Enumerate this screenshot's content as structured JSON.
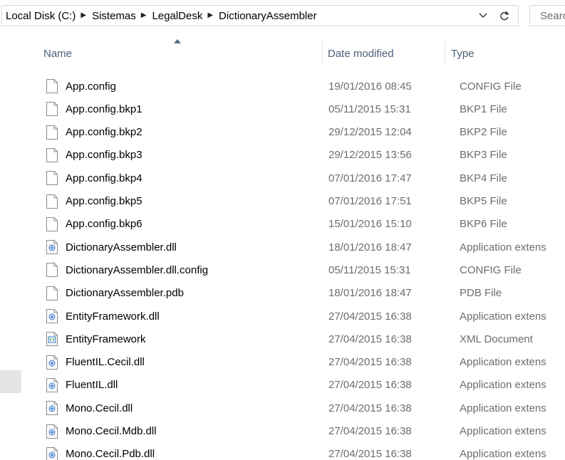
{
  "address": {
    "crumbs": [
      "Local Disk (C:)",
      "Sistemas",
      "LegalDesk",
      "DictionaryAssembler"
    ],
    "search_placeholder": "Search"
  },
  "columns": {
    "name": "Name",
    "date": "Date modified",
    "type": "Type",
    "sorted_by": "name"
  },
  "files": [
    {
      "name": "App.config",
      "date": "19/01/2016 08:45",
      "type": "CONFIG File",
      "icon": "blank-file-icon"
    },
    {
      "name": "App.config.bkp1",
      "date": "05/11/2015 15:31",
      "type": "BKP1 File",
      "icon": "blank-file-icon"
    },
    {
      "name": "App.config.bkp2",
      "date": "29/12/2015 12:04",
      "type": "BKP2 File",
      "icon": "blank-file-icon"
    },
    {
      "name": "App.config.bkp3",
      "date": "29/12/2015 13:56",
      "type": "BKP3 File",
      "icon": "blank-file-icon"
    },
    {
      "name": "App.config.bkp4",
      "date": "07/01/2016 17:47",
      "type": "BKP4 File",
      "icon": "blank-file-icon"
    },
    {
      "name": "App.config.bkp5",
      "date": "07/01/2016 17:51",
      "type": "BKP5 File",
      "icon": "blank-file-icon"
    },
    {
      "name": "App.config.bkp6",
      "date": "15/01/2016 15:10",
      "type": "BKP6 File",
      "icon": "blank-file-icon"
    },
    {
      "name": "DictionaryAssembler.dll",
      "date": "18/01/2016 18:47",
      "type": "Application extens",
      "icon": "dll-file-icon"
    },
    {
      "name": "DictionaryAssembler.dll.config",
      "date": "05/11/2015 15:31",
      "type": "CONFIG File",
      "icon": "blank-file-icon"
    },
    {
      "name": "DictionaryAssembler.pdb",
      "date": "18/01/2016 18:47",
      "type": "PDB File",
      "icon": "blank-file-icon"
    },
    {
      "name": "EntityFramework.dll",
      "date": "27/04/2015 16:38",
      "type": "Application extens",
      "icon": "dll-file-icon"
    },
    {
      "name": "EntityFramework",
      "date": "27/04/2015 16:38",
      "type": "XML Document",
      "icon": "xml-file-icon"
    },
    {
      "name": "FluentIL.Cecil.dll",
      "date": "27/04/2015 16:38",
      "type": "Application extens",
      "icon": "dll-file-icon"
    },
    {
      "name": "FluentIL.dll",
      "date": "27/04/2015 16:38",
      "type": "Application extens",
      "icon": "dll-file-icon"
    },
    {
      "name": "Mono.Cecil.dll",
      "date": "27/04/2015 16:38",
      "type": "Application extens",
      "icon": "dll-file-icon"
    },
    {
      "name": "Mono.Cecil.Mdb.dll",
      "date": "27/04/2015 16:38",
      "type": "Application extens",
      "icon": "dll-file-icon"
    },
    {
      "name": "Mono.Cecil.Pdb.dll",
      "date": "27/04/2015 16:38",
      "type": "Application extens",
      "icon": "dll-file-icon"
    }
  ],
  "colors": {
    "header_text": "#4c607a",
    "secondary_text": "#6d6d6d",
    "dll_icon_blue": "#3c78c8"
  }
}
